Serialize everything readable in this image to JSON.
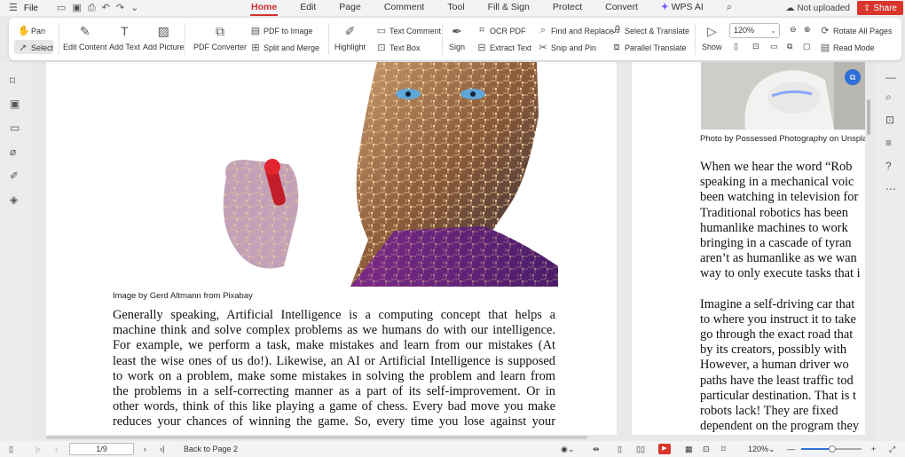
{
  "titlebar": {
    "file": "File",
    "menu": [
      "Home",
      "Edit",
      "Page",
      "Comment",
      "Tool",
      "Fill & Sign",
      "Protect",
      "Convert"
    ],
    "active": "Home",
    "wps_ai": "WPS AI",
    "not_uploaded": "Not uploaded",
    "share": "Share"
  },
  "ribbon": {
    "pan": "Pan",
    "select": "Select",
    "edit_content": "Edit Content",
    "add_text": "Add Text",
    "add_picture": "Add Picture",
    "pdf_converter": "PDF Converter",
    "pdf_to_image": "PDF to Image",
    "split_merge": "Split and Merge",
    "highlight": "Highlight",
    "text_comment": "Text Comment",
    "text_box": "Text Box",
    "sign": "Sign",
    "ocr_pdf": "OCR PDF",
    "extract_text": "Extract Text",
    "find_replace": "Find and Replace",
    "snip_pin": "Snip and Pin",
    "select_translate": "Select & Translate",
    "parallel_translate": "Parallel Translate",
    "show": "Show",
    "zoom": "120%",
    "rotate_all": "Rotate All Pages",
    "read_mode": "Read Mode"
  },
  "page1": {
    "caption": "Image by Gerd Altmann from Pixabay",
    "lines": [
      "Generally speaking, Artificial Intelligence is a computing concept that helps a",
      "machine think and solve complex problems as we humans do with our intelligence.",
      "For example, we perform a task, make mistakes and learn from our mistakes (At",
      "least the wise ones of us do!). Likewise, an AI or Artificial Intelligence is supposed",
      "to work on a problem, make some mistakes in solving the problem and learn from",
      "the problems in a self-correcting manner as a part of its self-improvement. Or in",
      "other words, think of this like playing a game of chess. Every bad move you make",
      "reduces your chances of winning the game. So, every time you lose against your"
    ]
  },
  "page2": {
    "caption": "Photo by Possessed Photography on Unsplash",
    "para1": [
      "When we hear the word “Rob",
      "speaking in a mechanical voic",
      "been watching in television for",
      "Traditional robotics has been",
      "humanlike machines to work",
      "bringing in a cascade of tyran",
      "aren’t as humanlike as we wan",
      "way to only execute tasks that i"
    ],
    "para2": [
      "Imagine a self-driving car that",
      "to where you instruct it to take",
      "go through the exact road that",
      "by its creators, possibly with",
      "However, a human driver wo",
      "paths have the least traffic tod",
      "particular destination. That is t",
      "robots lack! They are fixed",
      "dependent on the program they"
    ]
  },
  "status": {
    "page": "1/9",
    "back": "Back to Page 2",
    "zoom": "120%"
  }
}
